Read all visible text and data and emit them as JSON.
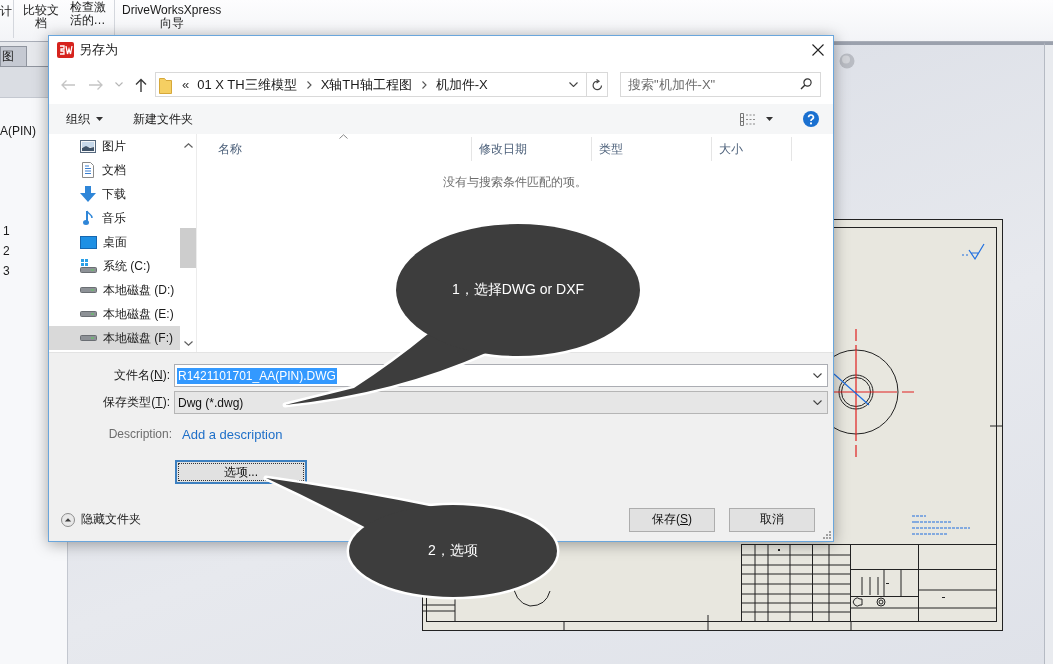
{
  "app": {
    "ribbon": [
      {
        "lines": [
          "计"
        ]
      },
      {
        "lines": [
          "比较文",
          "档"
        ]
      },
      {
        "lines": [
          "检查激",
          "活的…"
        ]
      },
      {
        "lines": [
          "DriveWorksXpress",
          "向导"
        ]
      }
    ],
    "tabs": [
      {
        "label": "图",
        "selected": true
      }
    ],
    "tree": [
      {
        "label": "A(PIN)"
      },
      {
        "label": "1"
      },
      {
        "label": "2"
      },
      {
        "label": "3"
      }
    ]
  },
  "dialog": {
    "title": "另存为",
    "address": {
      "overflow": "«",
      "path": [
        "01 X TH三维模型",
        "X轴TH轴工程图",
        "机加件-X"
      ]
    },
    "search": {
      "placeholder": "搜索\"机加件-X\""
    },
    "toolbar": {
      "organize": "组织",
      "new_folder": "新建文件夹"
    },
    "nav": [
      {
        "label": "图片",
        "kind": "pictures",
        "selected": false
      },
      {
        "label": "文档",
        "kind": "documents",
        "selected": false
      },
      {
        "label": "下载",
        "kind": "downloads",
        "selected": false
      },
      {
        "label": "音乐",
        "kind": "music",
        "selected": false
      },
      {
        "label": "桌面",
        "kind": "desktop",
        "selected": false
      },
      {
        "label": "系统 (C:)",
        "kind": "system-drive",
        "selected": false
      },
      {
        "label": "本地磁盘 (D:)",
        "kind": "drive",
        "selected": false
      },
      {
        "label": "本地磁盘 (E:)",
        "kind": "drive",
        "selected": false
      },
      {
        "label": "本地磁盘 (F:)",
        "kind": "drive",
        "selected": true
      }
    ],
    "columns": [
      {
        "label": "名称",
        "sorted": true
      },
      {
        "label": "修改日期",
        "sorted": false
      },
      {
        "label": "类型",
        "sorted": false
      },
      {
        "label": "大小",
        "sorted": false
      }
    ],
    "empty_message": "没有与搜索条件匹配的项。",
    "fields": [
      {
        "kind": "text",
        "label": [
          {
            "text": "文件名("
          },
          {
            "text": "N",
            "underline": true
          },
          {
            "text": "):"
          }
        ],
        "value": "R1421101701_AA(PIN).DWG",
        "selected": true
      },
      {
        "kind": "dropdown",
        "label": [
          {
            "text": "保存类型("
          },
          {
            "text": "T",
            "underline": true
          },
          {
            "text": "):"
          }
        ],
        "value": "Dwg (*.dwg)",
        "selected": false
      }
    ],
    "description": {
      "label": "Description:",
      "link": "Add a description"
    },
    "options_button": {
      "label": "选项...",
      "focused": true
    },
    "hide_folders": "隐藏文件夹",
    "buttons": [
      {
        "label": [
          {
            "text": "保存("
          },
          {
            "text": "S",
            "underline": true
          },
          {
            "text": ")"
          }
        ]
      },
      {
        "label": [
          {
            "text": "取消"
          }
        ]
      }
    ]
  },
  "callouts": [
    {
      "text": "1，选择DWG or DXF"
    },
    {
      "text": "2，选项"
    }
  ]
}
